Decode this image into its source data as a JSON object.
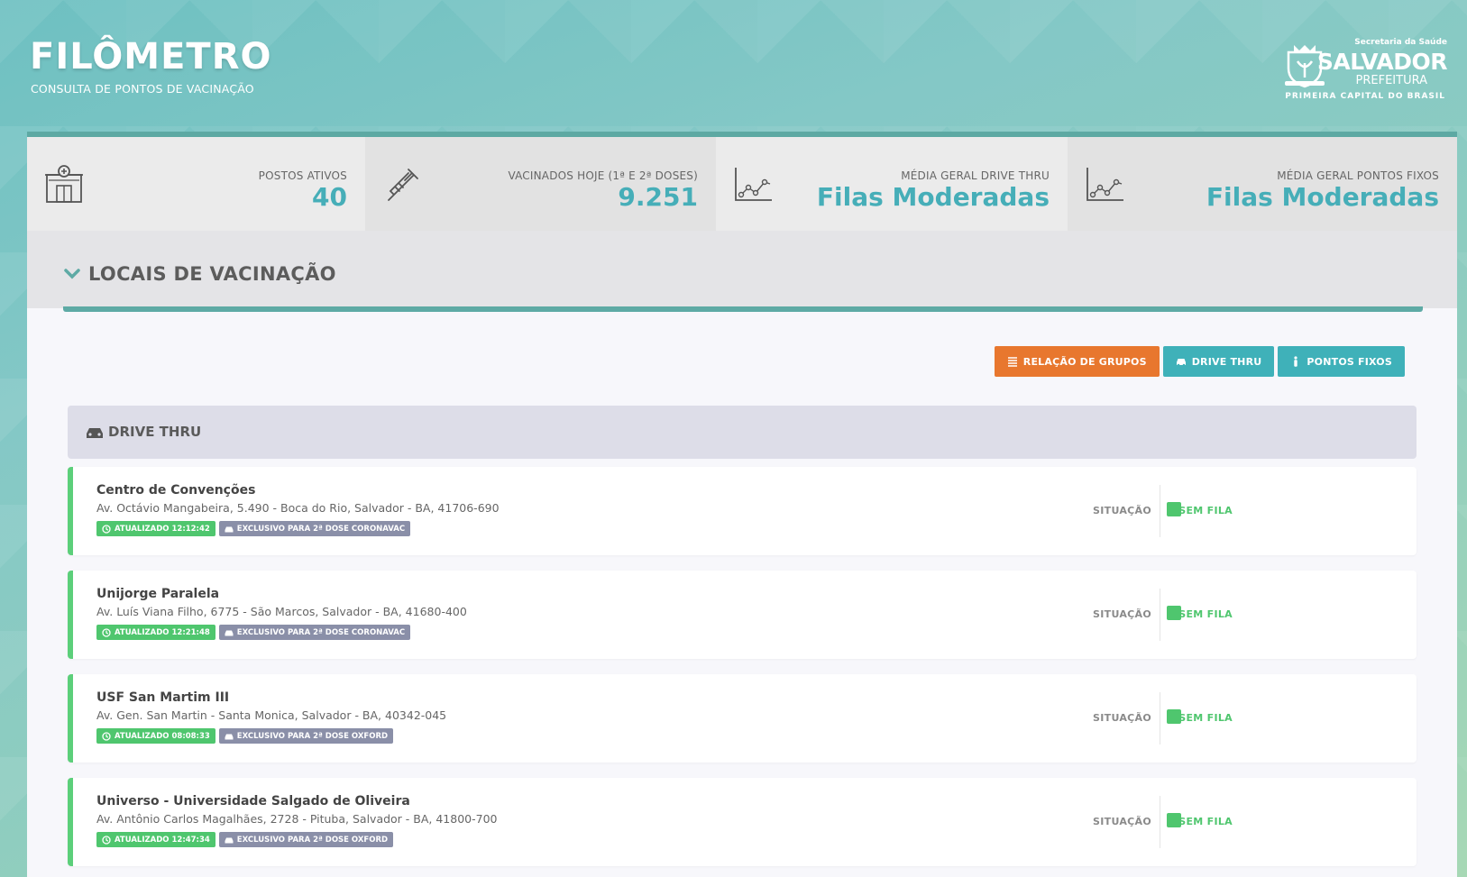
{
  "header": {
    "title": "FILÔMETRO",
    "subtitle": "CONSULTA DE PONTOS DE VACINAÇÃO",
    "logo": {
      "secretaria": "Secretaria da Saúde",
      "city": "SALVADOR",
      "prefeitura": "PREFEITURA",
      "tagline": "PRIMEIRA CAPITAL DO BRASIL"
    }
  },
  "stats": [
    {
      "icon": "building-icon",
      "label": "POSTOS ATIVOS",
      "value": "40"
    },
    {
      "icon": "syringe-icon",
      "label": "VACINADOS HOJE (1ª E 2ª DOSES)",
      "value": "9.251"
    },
    {
      "icon": "line-chart-icon",
      "label": "MÉDIA GERAL DRIVE THRU",
      "value": "Filas Moderadas"
    },
    {
      "icon": "line-chart-icon",
      "label": "MÉDIA GERAL PONTOS FIXOS",
      "value": "Filas Moderadas"
    }
  ],
  "section": {
    "title": "LOCAIS DE VACINAÇÃO"
  },
  "buttons": {
    "groups": "RELAÇÃO DE GRUPOS",
    "drive_thru": "DRIVE THRU",
    "fixed_points": "PONTOS FIXOS"
  },
  "group": {
    "title": "DRIVE THRU"
  },
  "locations": [
    {
      "name": "Centro de Convenções",
      "address": "Av. Octávio Mangabeira, 5.490 - Boca do Rio, Salvador - BA, 41706-690",
      "updated": "ATUALIZADO 12:12:42",
      "exclusive": "EXCLUSIVO PARA 2ª DOSE CORONAVAC",
      "situation_label": "SITUAÇÃO",
      "status": "SEM FILA"
    },
    {
      "name": "Unijorge Paralela",
      "address": "Av. Luís Viana Filho, 6775 - São Marcos, Salvador - BA, 41680-400",
      "updated": "ATUALIZADO 12:21:48",
      "exclusive": "EXCLUSIVO PARA 2ª DOSE CORONAVAC",
      "situation_label": "SITUAÇÃO",
      "status": "SEM FILA"
    },
    {
      "name": "USF San Martim III",
      "address": "Av. Gen. San Martin - Santa Monica, Salvador - BA, 40342-045",
      "updated": "ATUALIZADO 08:08:33",
      "exclusive": "EXCLUSIVO PARA 2ª DOSE OXFORD",
      "situation_label": "SITUAÇÃO",
      "status": "SEM FILA"
    },
    {
      "name": "Universo - Universidade Salgado de Oliveira",
      "address": "Av. Antônio Carlos Magalhães, 2728 - Pituba, Salvador - BA, 41800-700",
      "updated": "ATUALIZADO 12:47:34",
      "exclusive": "EXCLUSIVO PARA 2ª DOSE OXFORD",
      "situation_label": "SITUAÇÃO",
      "status": "SEM FILA"
    }
  ],
  "colors": {
    "accent_teal": "#3fb1b9",
    "accent_orange": "#e8772e",
    "status_green": "#4fc66e",
    "tag_gray": "#8a8fa8"
  }
}
